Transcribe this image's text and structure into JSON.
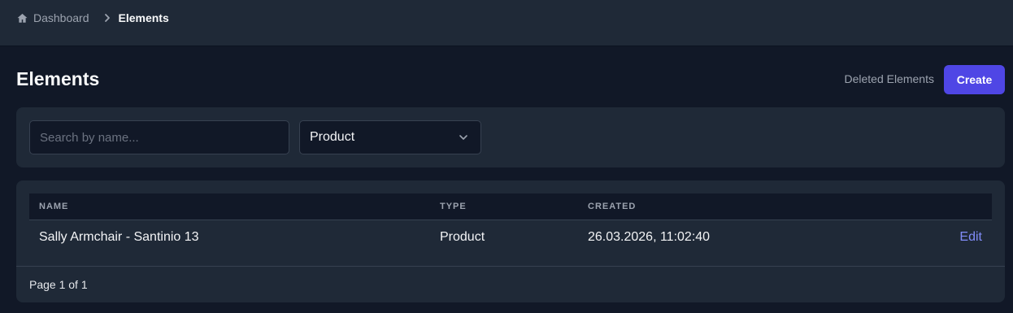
{
  "breadcrumb": {
    "home_icon": "home-icon",
    "home_label": "Dashboard",
    "separator_icon": "chevron-right-icon",
    "current_label": "Elements"
  },
  "header": {
    "title": "Elements",
    "deleted_label": "Deleted Elements",
    "create_label": "Create"
  },
  "filters": {
    "search_placeholder": "Search by name...",
    "search_value": "",
    "type_selected": "Product",
    "type_icon": "chevron-down-icon"
  },
  "table": {
    "columns": [
      "NAME",
      "TYPE",
      "CREATED"
    ],
    "rows": [
      {
        "name": "Sally Armchair - Santinio 13",
        "type": "Product",
        "created": "26.03.2026, 11:02:40",
        "action": "Edit"
      }
    ],
    "pagination": "Page 1 of 1"
  },
  "colors": {
    "background": "#111827",
    "card": "#1f2937",
    "accent": "#4f46e5",
    "link": "#818cf8"
  }
}
